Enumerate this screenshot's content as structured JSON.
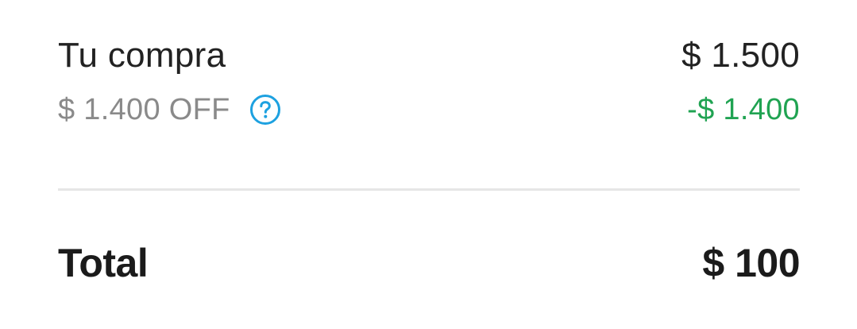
{
  "summary": {
    "purchase": {
      "label": "Tu compra",
      "value": "$ 1.500"
    },
    "discount": {
      "label": "$ 1.400 OFF",
      "icon": "help-question-icon",
      "value": "-$ 1.400"
    },
    "total": {
      "label": "Total",
      "value": "$ 100"
    }
  },
  "colors": {
    "text_primary": "#222222",
    "text_secondary": "#8a8a8a",
    "discount_green": "#20a352",
    "help_icon_blue": "#1da1e0",
    "divider": "#e6e6e6"
  }
}
